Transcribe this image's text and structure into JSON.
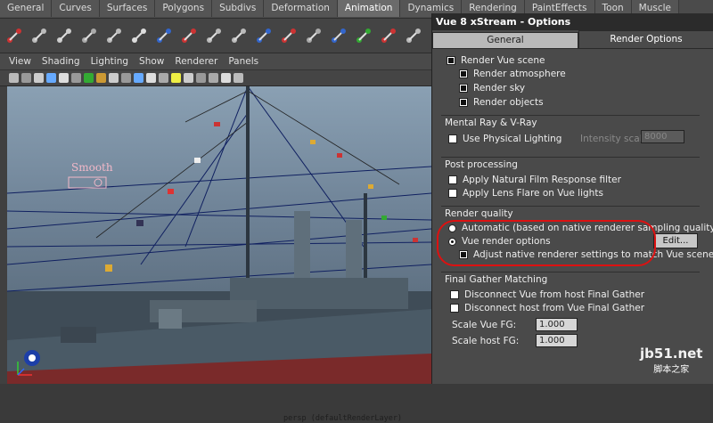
{
  "maya": {
    "shelf_tabs": [
      {
        "label": "General"
      },
      {
        "label": "Curves"
      },
      {
        "label": "Surfaces"
      },
      {
        "label": "Polygons"
      },
      {
        "label": "Subdivs"
      },
      {
        "label": "Deformation"
      },
      {
        "label": "Animation",
        "active": true
      },
      {
        "label": "Dynamics"
      },
      {
        "label": "Rendering"
      },
      {
        "label": "PaintEffects"
      },
      {
        "label": "Toon"
      },
      {
        "label": "Muscle"
      }
    ],
    "shelf_icons": [
      "joint-icon",
      "ik-handle-icon",
      "ik-spline-icon",
      "character-icon",
      "skeleton-icon",
      "bind-icon",
      "joint-tool-icon",
      "ik-tool-icon",
      "connect-icon",
      "chain-icon",
      "mirror-icon",
      "paint-weights-icon",
      "weight-tool-icon",
      "locator-icon",
      "constraint-icon",
      "orient-icon",
      "skin-icon",
      "figure-icon"
    ],
    "viewport_menu": [
      "View",
      "Shading",
      "Lighting",
      "Show",
      "Renderer",
      "Panels"
    ],
    "viewport_overlay": {
      "smooth_label": "Smooth",
      "layer_label": "persp (defaultRenderLayer)"
    }
  },
  "options": {
    "title": "Vue 8 xStream - Options",
    "tabs": [
      {
        "label": "General",
        "active": false
      },
      {
        "label": "Render Options",
        "active": true
      }
    ],
    "render_vue_scene": {
      "label": "Render Vue scene",
      "checked": true,
      "children": [
        {
          "label": "Render atmosphere",
          "checked": true
        },
        {
          "label": "Render sky",
          "checked": true
        },
        {
          "label": "Render objects",
          "checked": true
        }
      ]
    },
    "mental_ray": {
      "title": "Mental Ray & V-Ray",
      "use_physical_lighting": {
        "label": "Use Physical Lighting",
        "checked": false
      },
      "intensity_label": "Intensity scale:",
      "intensity_value": "8000"
    },
    "post_processing": {
      "title": "Post processing",
      "items": [
        {
          "label": "Apply Natural Film Response filter",
          "checked": false
        },
        {
          "label": "Apply Lens Flare on Vue lights",
          "checked": false
        }
      ]
    },
    "render_quality": {
      "title": "Render quality",
      "automatic": {
        "label": "Automatic (based on native renderer sampling quality)",
        "selected": false
      },
      "vue_render": {
        "label": "Vue render options",
        "selected": true
      },
      "adjust": {
        "label": "Adjust native renderer settings to match Vue scene",
        "checked": true
      },
      "edit_label": "Edit..."
    },
    "final_gather": {
      "title": "Final Gather Matching",
      "items": [
        {
          "label": "Disconnect Vue from host Final Gather",
          "checked": false
        },
        {
          "label": "Disconnect host from Vue Final Gather",
          "checked": false
        }
      ],
      "scale_vue_label": "Scale Vue FG:",
      "scale_vue_value": "1.000",
      "scale_host_label": "Scale host FG:",
      "scale_host_value": "1.000"
    }
  },
  "watermark": {
    "domain": "jb51.net",
    "tagline": "脚本之家"
  },
  "colors": {
    "highlight": "#dd1111",
    "viewport_bg": "#6d8195"
  }
}
